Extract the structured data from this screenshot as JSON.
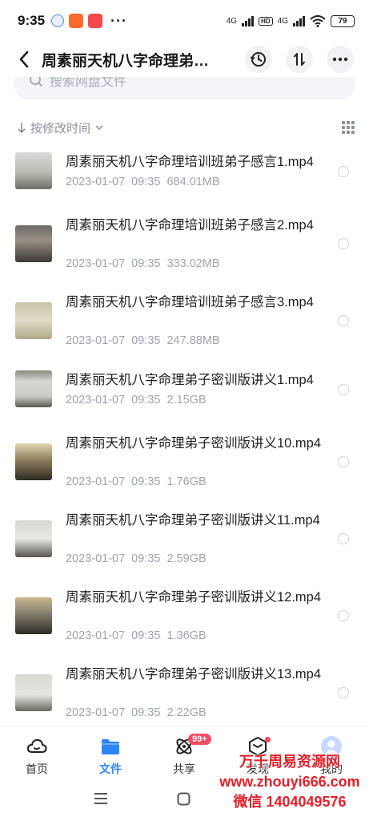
{
  "status_bar": {
    "time": "9:35",
    "network_1": "4G",
    "network_2": "4G",
    "hd": "HD",
    "battery": "79"
  },
  "header": {
    "title": "周素丽天机八字命理弟…",
    "back_icon": "back-arrow-icon",
    "history_icon": "history-icon",
    "sort_icon": "sort-icon",
    "more_icon": "more-icon"
  },
  "search": {
    "placeholder": "搜索网盘文件"
  },
  "sort": {
    "label": "按修改时间"
  },
  "files": [
    {
      "name": "周素丽天机八字命理培训班弟子感言1.mp4",
      "date": "2023-01-07",
      "time": "09:35",
      "size": "684.01MB"
    },
    {
      "name": "周素丽天机八字命理培训班弟子感言2.mp4",
      "date": "2023-01-07",
      "time": "09:35",
      "size": "333.02MB"
    },
    {
      "name": "周素丽天机八字命理培训班弟子感言3.mp4",
      "date": "2023-01-07",
      "time": "09:35",
      "size": "247.88MB"
    },
    {
      "name": "周素丽天机八字命理弟子密训版讲义1.mp4",
      "date": "2023-01-07",
      "time": "09:35",
      "size": "2.15GB"
    },
    {
      "name": "周素丽天机八字命理弟子密训版讲义10.mp4",
      "date": "2023-01-07",
      "time": "09:35",
      "size": "1.76GB"
    },
    {
      "name": "周素丽天机八字命理弟子密训版讲义11.mp4",
      "date": "2023-01-07",
      "time": "09:35",
      "size": "2.59GB"
    },
    {
      "name": "周素丽天机八字命理弟子密训版讲义12.mp4",
      "date": "2023-01-07",
      "time": "09:35",
      "size": "1.36GB"
    },
    {
      "name": "周素丽天机八字命理弟子密训版讲义13.mp4",
      "date": "2023-01-07",
      "time": "09:35",
      "size": "2.22GB"
    }
  ],
  "nav": {
    "home": "首页",
    "files": "文件",
    "share": "共享",
    "share_badge": "99+",
    "discover": "发现",
    "mine": "我的"
  },
  "watermark": {
    "line1": "万千周易资源网",
    "line2": "www.zhouyi666.com",
    "line3": "微信 1404049576"
  },
  "colors": {
    "accent": "#2d86f5",
    "badge": "#f44a63",
    "watermark": "#e0202a"
  }
}
